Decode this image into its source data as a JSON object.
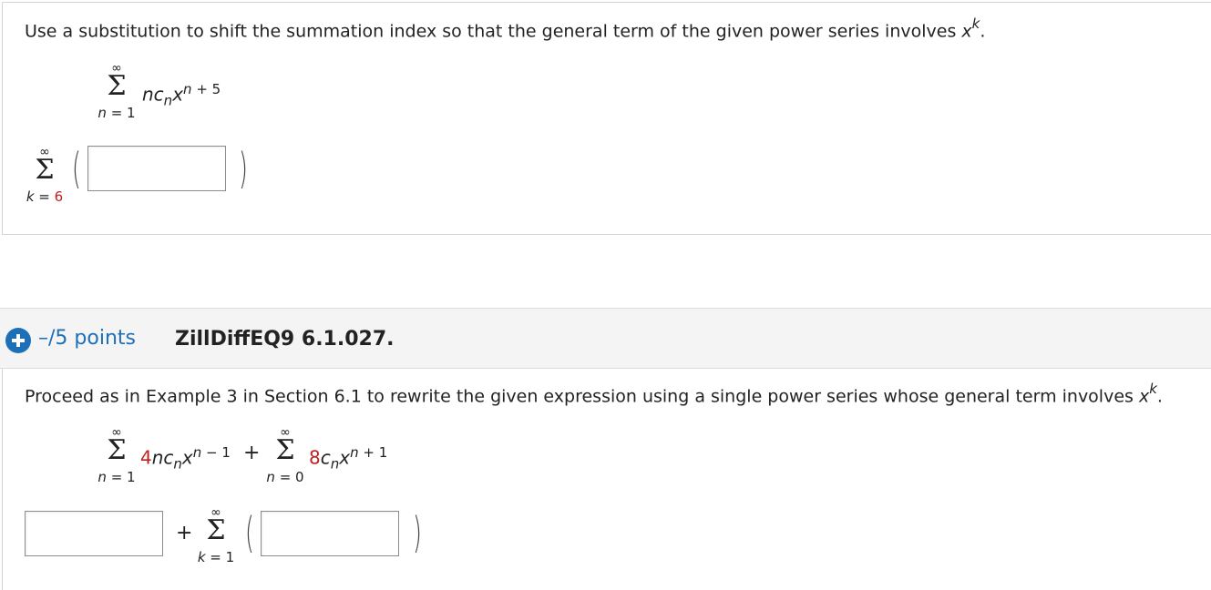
{
  "question1": {
    "instruction": "Use a substitution to shift the summation index so that the general term of the given power series involves ",
    "instruction_var": "x",
    "instruction_sup": "k",
    "instruction_end": ".",
    "given_sum": {
      "upper": "∞",
      "sigma": "Σ",
      "lower_var": "n",
      "lower_eq": " = 1",
      "term_coef": "nc",
      "term_sub": "n",
      "term_base": "x",
      "term_exp_var": "n",
      "term_exp_rest": " + 5"
    },
    "answer_sum": {
      "upper": "∞",
      "sigma": "Σ",
      "lower_var": "k",
      "lower_eq": " = ",
      "lower_value": "6"
    }
  },
  "question2": {
    "points": "–/5 points",
    "id": "ZillDiffEQ9 6.1.027.",
    "instruction": "Proceed as in Example 3 in Section 6.1 to rewrite the given expression using a single power series whose general term involves ",
    "instruction_var": "x",
    "instruction_sup": "k",
    "instruction_end": ".",
    "sum1": {
      "upper": "∞",
      "sigma": "Σ",
      "lower_var": "n",
      "lower_eq": " = 1",
      "coef": "4",
      "term_rest": "nc",
      "term_sub": "n",
      "term_base": "x",
      "exp_var": "n",
      "exp_rest": " − 1"
    },
    "plus": "+",
    "sum2": {
      "upper": "∞",
      "sigma": "Σ",
      "lower_var": "n",
      "lower_eq": " = 0",
      "coef": "8",
      "term_rest": "c",
      "term_sub": "n",
      "term_base": "x",
      "exp_var": "n",
      "exp_rest": " + 1"
    },
    "answer_plus": "+",
    "answer_sum": {
      "upper": "∞",
      "sigma": "Σ",
      "lower_var": "k",
      "lower_eq": " = 1"
    }
  }
}
